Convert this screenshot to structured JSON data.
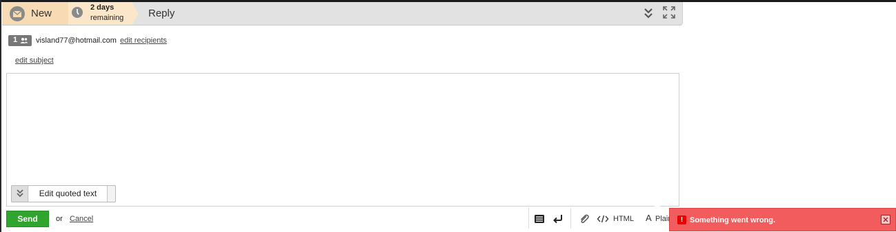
{
  "header": {
    "new_label": "New",
    "days_line1": "2 days",
    "days_line2": "remaining",
    "reply_label": "Reply"
  },
  "recipients": {
    "count": "1",
    "email": "visland77@hotmail.com",
    "edit_label": "edit recipients"
  },
  "subject": {
    "edit_label": "edit subject"
  },
  "editor": {
    "quote_button_label": "Edit quoted text"
  },
  "footer": {
    "send_label": "Send",
    "or_label": "or",
    "cancel_label": "Cancel",
    "html_label": "HTML",
    "plain_prefix": "A",
    "plain_label": "Plain"
  },
  "toast": {
    "message": "Something went wrong.",
    "icon_label": "!"
  },
  "colors": {
    "send_green": "#2fa42f",
    "toast_red": "#f25c5c",
    "header_orange": "#f6dbb5"
  }
}
